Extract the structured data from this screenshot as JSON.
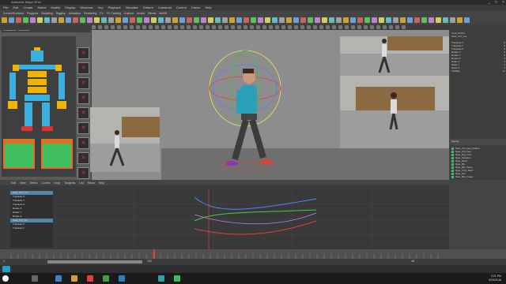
{
  "window": {
    "title": "Autodesk Maya 2016",
    "controls": [
      "_",
      "□",
      "×"
    ]
  },
  "menubar": {
    "items": [
      "File",
      "Edit",
      "Create",
      "Select",
      "Modify",
      "Display",
      "Windows",
      "Key",
      "Playback",
      "Visualize",
      "Deform",
      "Constrain",
      "Control",
      "Cache",
      "Help"
    ]
  },
  "shelf": {
    "tabs": [
      "Curves/Surfaces",
      "Polygons",
      "Sculpting",
      "Rigging",
      "Animation",
      "Rendering",
      "FX",
      "FX Caching",
      "Custom",
      "Arnold",
      "Bifrost",
      "MASH"
    ]
  },
  "left_panel": {
    "logo_text": "Character Selector"
  },
  "viewport": {
    "panel_label": "persp"
  },
  "right_panel": {
    "channel_title": "Channel Box",
    "node_name": "Nate_Ctrl_root",
    "attrs": [
      "Translate X",
      "Translate Y",
      "Translate Z",
      "Rotate X",
      "Rotate Y",
      "Rotate Z",
      "Scale X",
      "Scale Y",
      "Scale Z",
      "Visibility"
    ],
    "values": [
      "0",
      "0",
      "0",
      "0",
      "0",
      "0",
      "1",
      "1",
      "1",
      "on"
    ],
    "layers_title": "Display",
    "layers": [
      "Nate_Ctrl_Geo_hidden",
      "Nate_Ctrl_Geo",
      "Nate_Rig_Ctrls",
      "Nate_Skeleton",
      "Nate_Mesh",
      "Nate_BG",
      "Nate_BG_Plane",
      "Nate_Ctrls_Main",
      "Nate_Ref",
      "Nate_BG_Image"
    ]
  },
  "graph_editor": {
    "menu": [
      "Edit",
      "View",
      "Select",
      "Curves",
      "Keys",
      "Tangents",
      "List",
      "Show",
      "Help"
    ],
    "outliner": [
      "Nate_Ctrl_root",
      "Translate X",
      "Translate Y",
      "Translate Z",
      "Rotate X",
      "Rotate Y",
      "Rotate Z",
      "Nate_Ctrl_hip",
      "Translate X",
      "Translate Y"
    ],
    "colors": {
      "red": "#e04040",
      "green": "#40d040",
      "blue": "#5080ff"
    }
  },
  "timeline": {
    "start": "1",
    "end": "120",
    "current": "48"
  },
  "taskbar": {
    "time": "3:21 PM",
    "date": "6/24/2016"
  }
}
